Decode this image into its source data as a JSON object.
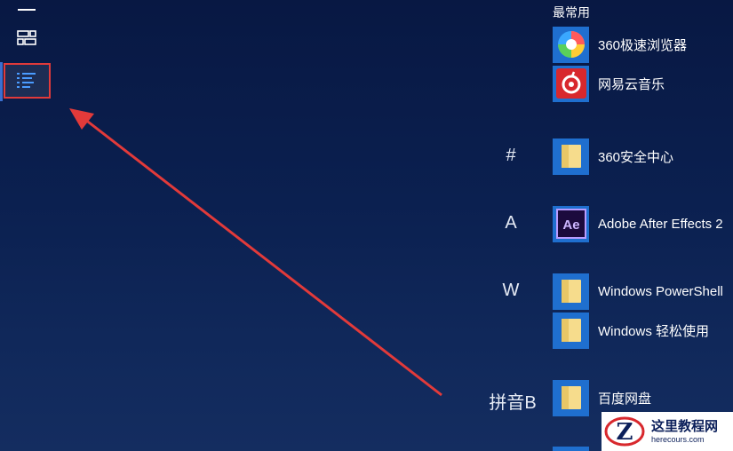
{
  "rail": {
    "items": [
      {
        "icon": "hamburger-menu-icon"
      },
      {
        "icon": "tiles-view-icon"
      },
      {
        "icon": "app-list-view-icon",
        "active": true,
        "highlighted": true
      }
    ]
  },
  "start_menu": {
    "section_most_used": "最常用",
    "most_used": [
      {
        "name": "360极速浏览器",
        "icon": "360-browser-icon"
      },
      {
        "name": "网易云音乐",
        "icon": "netease-music-icon"
      }
    ],
    "groups": [
      {
        "letter": "#",
        "apps": [
          {
            "name": "360安全中心",
            "icon": "folder-icon"
          }
        ]
      },
      {
        "letter": "A",
        "apps": [
          {
            "name": "Adobe After Effects 2",
            "icon": "after-effects-icon"
          }
        ]
      },
      {
        "letter": "W",
        "apps": [
          {
            "name": "Windows PowerShell",
            "icon": "folder-icon"
          },
          {
            "name": "Windows 轻松使用",
            "icon": "folder-icon"
          }
        ]
      },
      {
        "letter": "拼音B",
        "apps": [
          {
            "name": "百度网盘",
            "icon": "folder-icon"
          }
        ]
      }
    ]
  },
  "watermark": {
    "logo_letter": "Z",
    "title": "这里教程网",
    "url": "herecours.com"
  },
  "colors": {
    "accent_tile": "#1f6fcf",
    "highlight_border": "#e23a3a",
    "arrow": "#e23a3a"
  }
}
